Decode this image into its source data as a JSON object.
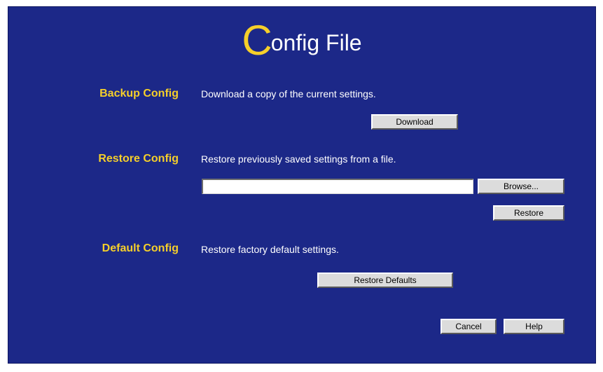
{
  "title": {
    "initial": "C",
    "rest": "onfig File"
  },
  "backup": {
    "label": "Backup Config",
    "description": "Download a copy of the current settings.",
    "download_button": "Download"
  },
  "restore": {
    "label": "Restore Config",
    "description": "Restore previously saved settings from a file.",
    "file_value": "",
    "browse_button": "Browse...",
    "restore_button": "Restore"
  },
  "default": {
    "label": "Default Config",
    "description": "Restore factory default settings.",
    "restore_defaults_button": "Restore Defaults"
  },
  "footer": {
    "cancel_button": "Cancel",
    "help_button": "Help"
  },
  "colors": {
    "background": "#1c2888",
    "accent": "#f5cf2a",
    "text": "#ffffff",
    "button_face": "#dcdcdc"
  }
}
